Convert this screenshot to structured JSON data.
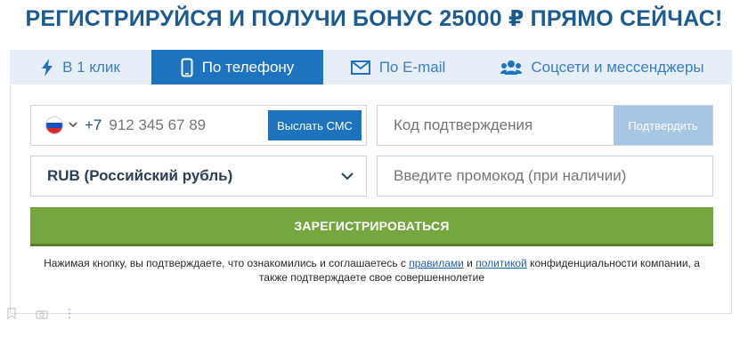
{
  "headline": "РЕГИСТРИРУЙСЯ И ПОЛУЧИ БОНУС 25000 ₽ ПРЯМО СЕЙЧАС!",
  "tabs": [
    {
      "label": "В 1 клик",
      "icon": "lightning-icon"
    },
    {
      "label": "По телефону",
      "icon": "phone-icon",
      "active": true
    },
    {
      "label": "По E-mail",
      "icon": "envelope-icon"
    },
    {
      "label": "Соцсети и мессенджеры",
      "icon": "users-icon"
    }
  ],
  "phone": {
    "country_flag": "russia-flag-icon",
    "prefix": "+7",
    "placeholder": "912 345 67 89",
    "send_sms_label": "Выслать СМС"
  },
  "code": {
    "placeholder": "Код подтверждения",
    "confirm_label": "Подтвердить"
  },
  "currency": {
    "selected": "RUB (Российский рубль)"
  },
  "promo": {
    "placeholder": "Введите промокод (при наличии)"
  },
  "register_label": "ЗАРЕГИСТРИРОВАТЬСЯ",
  "disclaimer": {
    "part1": "Нажимая кнопку, вы подтверждаете, что ознакомились и соглашаетесь с ",
    "rules_link": "правилами",
    "part2": " и ",
    "policy_link": "политикой",
    "part3": " конфиденциальности компании, а также подтверждаете свое совершеннолетие"
  },
  "colors": {
    "brand_blue": "#1e73be",
    "headline_blue": "#1d5a8e",
    "register_green": "#76a63f",
    "tab_bg": "#e6eff7",
    "confirm_disabled": "#a6c7e3"
  }
}
